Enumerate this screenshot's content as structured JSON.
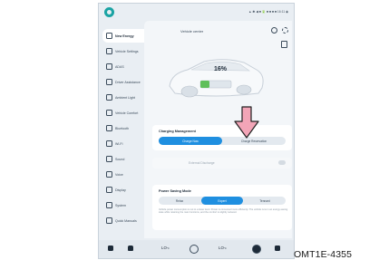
{
  "status": {
    "text": "▲ ✱ ◀ ■ 🔋 ■ ■ ■ ■ 16:11 ◉"
  },
  "sidebar": {
    "items": [
      {
        "label": "New Energy",
        "icon": "bolt-icon",
        "active": true
      },
      {
        "label": "Vehicle Settings",
        "icon": "car-settings-icon"
      },
      {
        "label": "ADAS",
        "icon": "adas-icon"
      },
      {
        "label": "Driver Assistance",
        "icon": "steering-icon"
      },
      {
        "label": "Ambient Light",
        "icon": "light-icon"
      },
      {
        "label": "Vehicle Comfort",
        "icon": "seat-icon"
      },
      {
        "label": "Bluetooth",
        "icon": "bluetooth-icon"
      },
      {
        "label": "Wi-Fi",
        "icon": "wifi-icon"
      },
      {
        "label": "Sound",
        "icon": "sound-icon"
      },
      {
        "label": "Voice",
        "icon": "voice-icon"
      },
      {
        "label": "Display",
        "icon": "display-icon"
      },
      {
        "label": "System",
        "icon": "system-icon"
      },
      {
        "label": "Quick Manuals",
        "icon": "manual-icon"
      }
    ]
  },
  "panel": {
    "title": "Vehicle center",
    "battery_percent": "16%"
  },
  "charging": {
    "title": "Charging Management",
    "options": [
      "Charge Now",
      "Charge Reservation"
    ],
    "selected": "Charge Now"
  },
  "discharge": {
    "label": "External Discharge"
  },
  "power": {
    "title": "Power Saving Mode",
    "options": [
      "Relax",
      "Expert",
      "Tennant"
    ],
    "selected": "Expert",
    "desc": "Vehicle power consumption is cut to a lower level. Power is consumed more efficiently. The vehicle runs in an energy-saving state while retaining the main functions, and the comfort is slightly reduced."
  },
  "bottombar": {
    "left_temp": "LO",
    "right_temp": "LO",
    "left_unit": "°C",
    "right_unit": "°C"
  },
  "caption": "OMT1E-4355",
  "colors": {
    "accent": "#1f8fe0",
    "arrow": "#f2a5b7",
    "battery": "#5fbf5a",
    "brand": "#1aa3a3"
  }
}
